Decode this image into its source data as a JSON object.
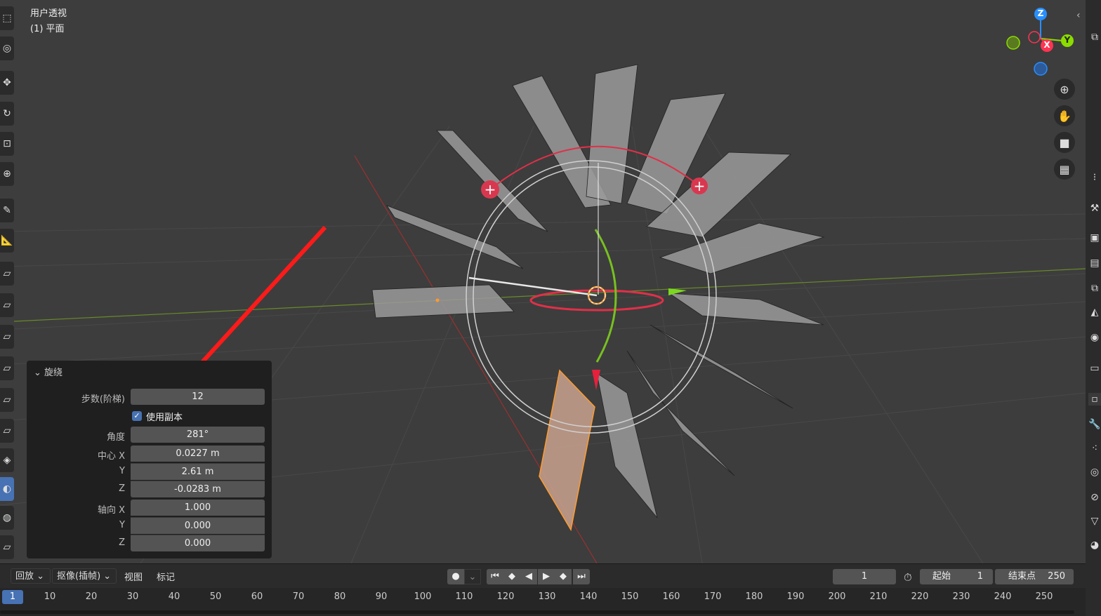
{
  "viewport": {
    "view_name": "用户透视",
    "object_label": "(1) 平面"
  },
  "gizmo": {
    "axis_z": "Z",
    "axis_x": "X",
    "axis_y": "Y"
  },
  "nav_buttons": [
    "zoom-icon",
    "hand-pan-icon",
    "camera-icon",
    "grid-ortho-icon"
  ],
  "operator_panel": {
    "title": "旋绕",
    "steps_label": "步数(阶梯)",
    "steps_value": "12",
    "use_duplicates_label": "使用副本",
    "use_duplicates_checked": true,
    "angle_label": "角度",
    "angle_value": "281°",
    "center_label": "中心 X",
    "center_x": "0.0227 m",
    "center_y_label": "Y",
    "center_y": "2.61 m",
    "center_z_label": "Z",
    "center_z": "-0.0283 m",
    "axis_label": "轴向 X",
    "axis_x": "1.000",
    "axis_y_label": "Y",
    "axis_y": "0.000",
    "axis_z_label": "Z",
    "axis_z": "0.000"
  },
  "timeline_header": {
    "playback": "回放",
    "keying": "抠像(插帧)",
    "view": "视图",
    "marker": "标记",
    "current_frame": "1",
    "start_label": "起始",
    "start_value": "1",
    "end_label": "结束点",
    "end_value": "250"
  },
  "timeline": {
    "current_frame": "1",
    "frames": [
      "10",
      "20",
      "30",
      "40",
      "50",
      "60",
      "70",
      "80",
      "90",
      "100",
      "110",
      "120",
      "130",
      "140",
      "150",
      "160",
      "170",
      "180",
      "190",
      "200",
      "210",
      "220",
      "230",
      "240",
      "250"
    ]
  },
  "colors": {
    "accent": "#4772b3",
    "annotation_arrow": "#ff1a1a",
    "axis_x": "#ff3352",
    "axis_y": "#8bdc00",
    "axis_z": "#2890ff"
  }
}
